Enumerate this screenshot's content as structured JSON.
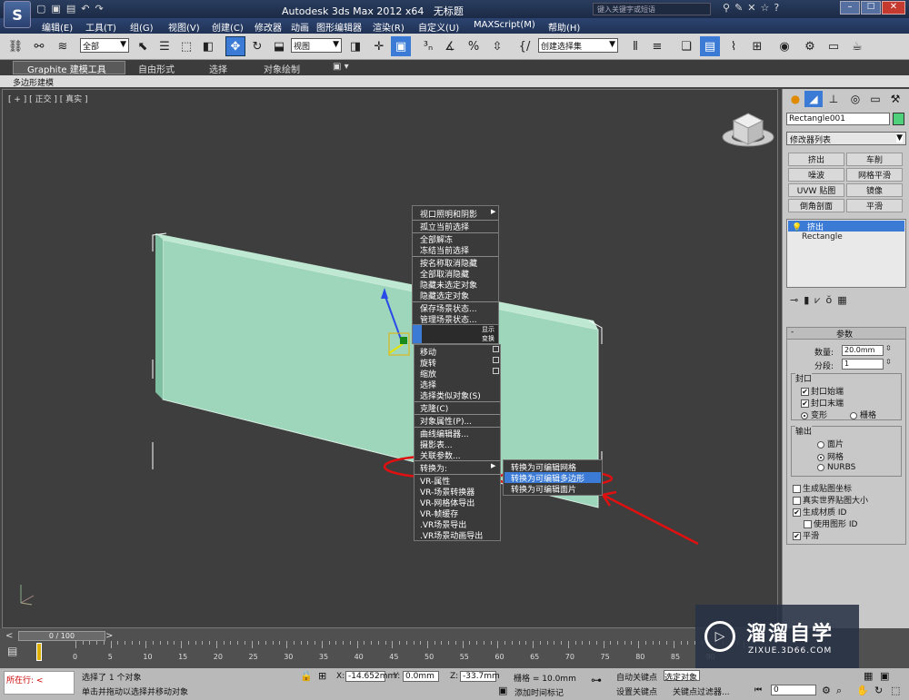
{
  "title": {
    "app": "Autodesk 3ds Max  2012 x64",
    "file": "无标题",
    "search_placeholder": "键入关键字或短语"
  },
  "menus": [
    "编辑(E)",
    "工具(T)",
    "组(G)",
    "视图(V)",
    "创建(C)",
    "修改器",
    "动画",
    "图形编辑器",
    "渲染(R)",
    "自定义(U)",
    "MAXScript(M)",
    "帮助(H)"
  ],
  "toolbar": {
    "selection_filter": "全部",
    "ref_coord": "视图",
    "named_selection": "创建选择集"
  },
  "ribbon": {
    "tabs": [
      "Graphite 建模工具",
      "自由形式",
      "选择",
      "对象绘制"
    ],
    "subtab": "多边形建模"
  },
  "viewport": {
    "label": "[ + ] [ 正交 ] [ 真实 ]"
  },
  "quad_menu": {
    "top_items": [
      "视口照明和阴影",
      "孤立当前选择",
      "全部解冻",
      "冻结当前选择",
      "按名称取消隐藏",
      "全部取消隐藏",
      "隐藏未选定对象",
      "隐藏选定对象",
      "保存场景状态...",
      "管理场景状态..."
    ],
    "display_label": "显示",
    "transform_label": "变换",
    "bottom_items": [
      "移动",
      "旋转",
      "缩放",
      "选择",
      "选择类似对象(S)",
      "克隆(C)",
      "对象属性(P)...",
      "曲线编辑器...",
      "摄影表...",
      "关联参数...",
      "转换为:",
      "VR-属性",
      "VR-场景转换器",
      "VR-网格体导出",
      "VR-帧缓存",
      ".VR场景导出",
      ".VR场景动画导出"
    ],
    "submenu": [
      "转换为可编辑网格",
      "转换为可编辑多边形",
      "转换为可编辑面片"
    ]
  },
  "command_panel": {
    "object_name": "Rectangle001",
    "object_color": "#4fd07a",
    "modifier_list": "修改器列表",
    "modifier_buttons": [
      "挤出",
      "车削",
      "噪波",
      "网格平滑",
      "UVW 贴图",
      "镜像",
      "倒角剖面",
      "平滑"
    ],
    "stack": [
      "挤出",
      "Rectangle"
    ],
    "rollout_title": "参数",
    "amount_label": "数量:",
    "amount_value": "20.0mm",
    "segments_label": "分段:",
    "segments_value": "1",
    "capping_group": "封口",
    "cap_start": "封口始端",
    "cap_end": "封口末端",
    "morph": "变形",
    "grid": "栅格",
    "output_group": "输出",
    "patch": "面片",
    "mesh": "网格",
    "nurbs": "NURBS",
    "gen_map_coords": "生成贴图坐标",
    "real_world": "真实世界贴图大小",
    "gen_mat_ids": "生成材质 ID",
    "use_shape_ids": "使用图形 ID",
    "smooth": "平滑"
  },
  "timeline": {
    "frame": "0 / 100",
    "ticks": [
      "0",
      "5",
      "10",
      "15",
      "20",
      "25",
      "30",
      "35",
      "40",
      "45",
      "50",
      "55",
      "60",
      "65",
      "70",
      "75",
      "80",
      "85",
      "90"
    ]
  },
  "status": {
    "maxscript_prompt": "所在行:",
    "selection_msg": "选择了 1 个对象",
    "hint": "单击并拖动以选择并移动对象",
    "x_label": "X:",
    "x_value": "-14.652mm",
    "y_label": "Y:",
    "y_value": "0.0mm",
    "z_label": "Z:",
    "z_value": "-33.7mm",
    "grid": "栅格 = 10.0mm",
    "auto_key": "自动关键点",
    "selected": "选定对象",
    "set_key": "设置关键点",
    "key_filters": "关键点过滤器...",
    "add_time_tag": "添加时间标记",
    "frame_field": "0"
  },
  "watermark": {
    "brand": "溜溜自学",
    "url": "ZIXUE.3D66.COM"
  }
}
